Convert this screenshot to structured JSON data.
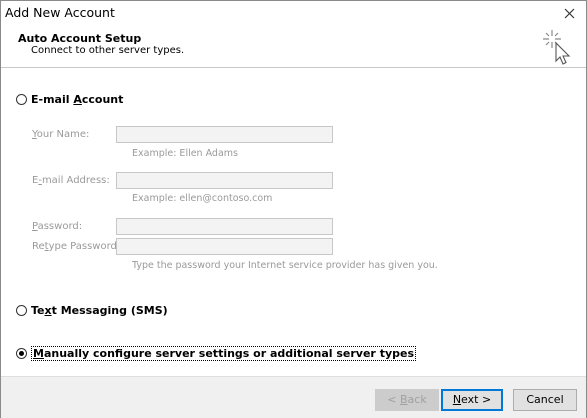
{
  "window": {
    "title": "Add New Account"
  },
  "header": {
    "title": "Auto Account Setup",
    "subtitle": "Connect to other server types.",
    "icon": "wizard-sparkle-cursor-icon"
  },
  "email_option": {
    "label_pre": "E-mail ",
    "label_access": "A",
    "label_post": "ccount",
    "selected": false,
    "fields": {
      "name_label_access": "Y",
      "name_label_rest": "our Name:",
      "name_value": "",
      "name_hint": "Example: Ellen Adams",
      "email_label_pre": "E",
      "email_label_access": "-",
      "email_label_rest": "mail Address:",
      "email_value": "",
      "email_hint": "Example: ellen@contoso.com",
      "password_label_access": "P",
      "password_label_rest": "assword:",
      "password_value": "",
      "retype_label_pre": "Re",
      "retype_label_access": "t",
      "retype_label_rest": "ype Password:",
      "retype_value": "",
      "password_hint": "Type the password your Internet service provider has given you."
    }
  },
  "sms_option": {
    "label_pre": "Te",
    "label_access": "x",
    "label_post": "t Messaging (SMS)",
    "selected": false
  },
  "manual_option": {
    "label_access": "M",
    "label_post": "anually configure server settings or additional server types",
    "selected": true
  },
  "footer": {
    "back_pre": "< ",
    "back_access": "B",
    "back_post": "ack",
    "next_access": "N",
    "next_post": "ext >",
    "cancel_label": "Cancel"
  }
}
